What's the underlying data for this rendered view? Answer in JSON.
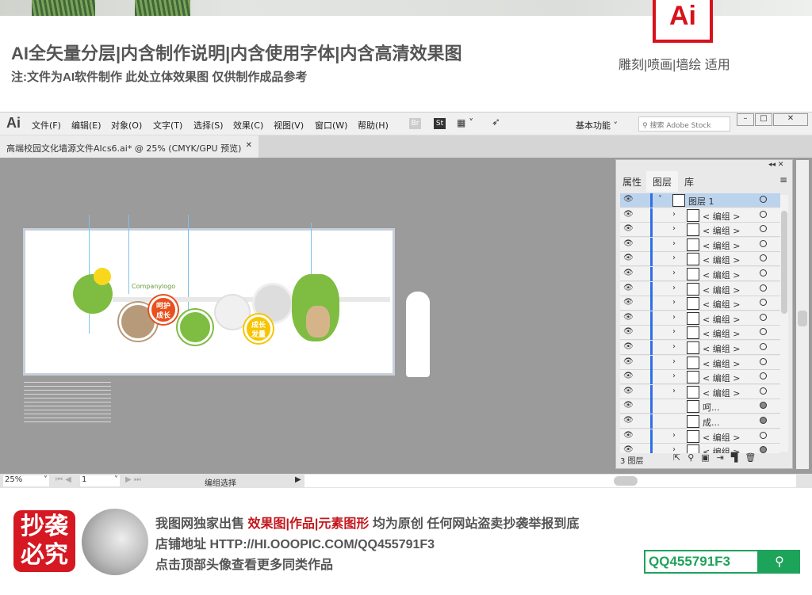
{
  "promo": {
    "ai_logo": "Ai",
    "headline": "AI全矢量分层|内含制作说明|内含使用字体|内含高清效果图",
    "subline": "注:文件为AI软件制作 此处立体效果图 仅供制作成品参考",
    "usage": "雕刻|喷画|墙绘 适用"
  },
  "app": {
    "logo": "Ai",
    "menu": [
      "文件(F)",
      "编辑(E)",
      "对象(O)",
      "文字(T)",
      "选择(S)",
      "效果(C)",
      "视图(V)",
      "窗口(W)",
      "帮助(H)"
    ],
    "toolbar": {
      "br": "Br",
      "st": "St",
      "workspace": "基本功能",
      "search_placeholder": "搜索 Adobe Stock"
    },
    "doc_tab": "高端校园文化墙源文件AIcs6.ai* @ 25% (CMYK/GPU 预览)",
    "artboard": {
      "logo_text": "Companylogo",
      "badge1": "呵护成长",
      "badge2": "成长发量"
    },
    "panel": {
      "tabs": [
        "属性",
        "图层",
        "库"
      ],
      "active_tab": "图层",
      "rows": [
        {
          "name": "图层 1",
          "expanded": true,
          "selected": true,
          "target_filled": false
        },
        {
          "name": "< 编组 >",
          "target_filled": false
        },
        {
          "name": "< 编组 >",
          "target_filled": false
        },
        {
          "name": "< 编组 >",
          "target_filled": false
        },
        {
          "name": "< 编组 >",
          "target_filled": false
        },
        {
          "name": "< 编组 >",
          "target_filled": false
        },
        {
          "name": "< 编组 >",
          "target_filled": false
        },
        {
          "name": "< 编组 >",
          "target_filled": false
        },
        {
          "name": "< 编组 >",
          "target_filled": false
        },
        {
          "name": "< 编组 >",
          "target_filled": false
        },
        {
          "name": "< 编组 >",
          "target_filled": false
        },
        {
          "name": "< 编组 >",
          "target_filled": false
        },
        {
          "name": "< 编组 >",
          "target_filled": false
        },
        {
          "name": "< 编组 >",
          "target_filled": false
        },
        {
          "name": "呵...",
          "target_filled": true
        },
        {
          "name": "成...",
          "target_filled": true
        },
        {
          "name": "< 编组 >",
          "target_filled": false
        },
        {
          "name": "< 编组 >",
          "target_filled": true
        }
      ],
      "footer": "3 图层"
    },
    "status": {
      "zoom": "25%",
      "page": "1",
      "tool": "编组选择"
    }
  },
  "footer": {
    "stamp": "抄袭必究",
    "line1_a": "我图网独家出售 ",
    "line1_red": "效果图|作品|元素图形",
    "line1_b": " 均为原创 任何网站盗卖抄袭举报到底",
    "line2": "店铺地址 HTTP://HI.OOOPIC.COM/QQ455791F3",
    "line3": "点击顶部头像查看更多同类作品",
    "search_value": "QQ455791F3"
  },
  "colors": {
    "brand_red": "#d8121b",
    "green": "#1ea35b",
    "selection": "#bcd3ee",
    "layer_color": "#2f6fe6"
  }
}
